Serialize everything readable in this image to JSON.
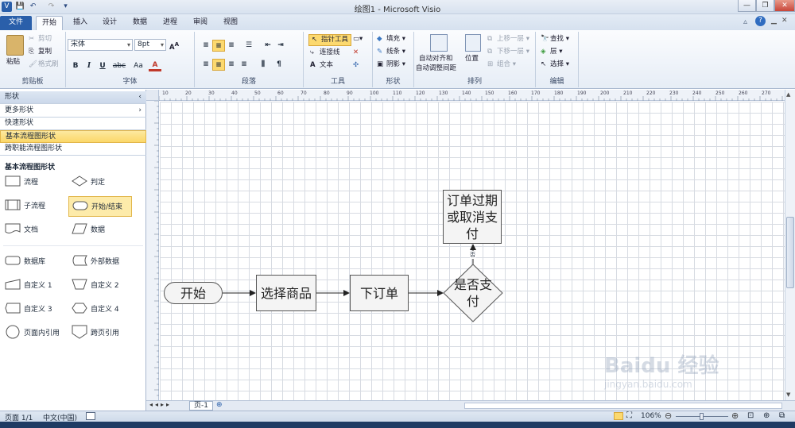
{
  "window": {
    "title": "绘图1 - Microsoft Visio"
  },
  "quick_access": [
    "V",
    "💾",
    "↶",
    "↷",
    "▾"
  ],
  "tabs": [
    {
      "label": "文件"
    },
    {
      "label": "开始"
    },
    {
      "label": "插入"
    },
    {
      "label": "设计"
    },
    {
      "label": "数据"
    },
    {
      "label": "进程"
    },
    {
      "label": "审阅"
    },
    {
      "label": "视图"
    }
  ],
  "ribbon": {
    "clipboard": {
      "paste": "粘贴",
      "cut": "剪切",
      "copy": "复制",
      "format_painter": "格式刷",
      "group": "剪贴板"
    },
    "font": {
      "name": "宋体",
      "size": "8pt",
      "group": "字体",
      "bold": "B",
      "italic": "I",
      "underline": "U",
      "strike": "abc",
      "case": "Aa",
      "color": "A"
    },
    "paragraph": {
      "group": "段落"
    },
    "tools": {
      "pointer": "指针工具",
      "connector": "连接线",
      "text": "文本",
      "group": "工具"
    },
    "shape": {
      "fill": "填充",
      "line": "线条",
      "shadow": "阴影",
      "group": "形状"
    },
    "arrange": {
      "auto_align": "自动对齐和",
      "auto_align2": "自动调整间距",
      "position": "位置",
      "bring_forward": "上移一层",
      "send_backward": "下移一层",
      "group_btn": "组合",
      "group": "排列"
    },
    "editing": {
      "find": "查找",
      "layer": "层",
      "select": "选择",
      "group": "编辑"
    }
  },
  "shapes_pane": {
    "header": "形状",
    "items": [
      {
        "label": "更多形状"
      },
      {
        "label": "快速形状"
      },
      {
        "label": "基本流程图形状"
      },
      {
        "label": "跨职能流程图形状"
      }
    ],
    "stencil_title": "基本流程图形状",
    "stencil": [
      {
        "label": "流程"
      },
      {
        "label": "判定"
      },
      {
        "label": "子流程"
      },
      {
        "label": "开始/结束"
      },
      {
        "label": "文档"
      },
      {
        "label": "数据"
      },
      {
        "label": "数据库"
      },
      {
        "label": "外部数据"
      },
      {
        "label": "自定义 1"
      },
      {
        "label": "自定义 2"
      },
      {
        "label": "自定义 3"
      },
      {
        "label": "自定义 4"
      },
      {
        "label": "页面内引用"
      },
      {
        "label": "跨页引用"
      }
    ]
  },
  "ruler_ticks": [
    "10",
    "20",
    "30",
    "40",
    "50",
    "60",
    "70",
    "80",
    "90",
    "100",
    "110",
    "120",
    "130",
    "140",
    "150",
    "160",
    "170",
    "180",
    "190",
    "200",
    "210",
    "220",
    "230",
    "240",
    "250",
    "260",
    "270"
  ],
  "diagram": {
    "start": "开始",
    "select": "选择商品",
    "order": "下订单",
    "decision": "是否支付",
    "cancel": "订单过期或取消支付",
    "no_label": "否"
  },
  "page_tab": "页-1",
  "status": {
    "page": "页面 1/1",
    "language": "中文(中国)",
    "zoom": "106%"
  },
  "watermark": "Baidu 经验",
  "watermark_sub": "jingyan.baidu.com"
}
